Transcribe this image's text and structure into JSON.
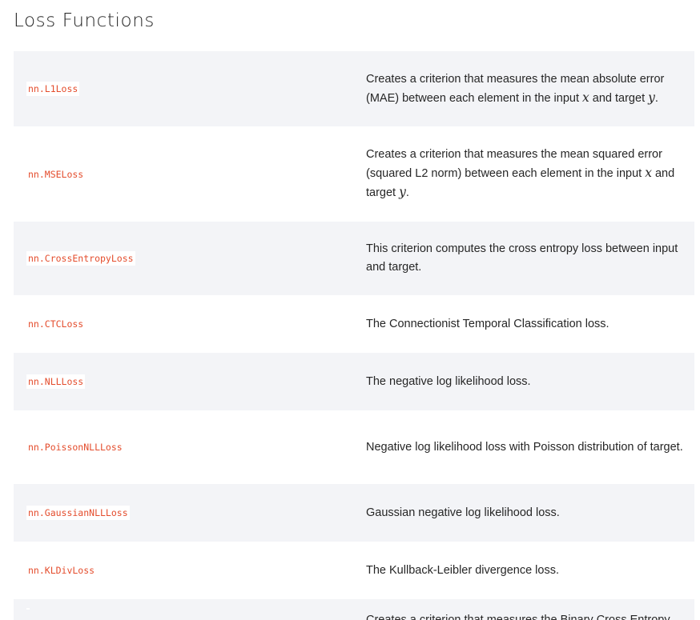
{
  "page": {
    "title": "Loss Functions"
  },
  "rows": [
    {
      "name": "nn.L1Loss",
      "desc_before": "Creates a criterion that measures the mean absolute error (MAE) between each element in the input ",
      "var1": "x",
      "desc_middle": " and target ",
      "var2": "y",
      "desc_after": "."
    },
    {
      "name": "nn.MSELoss",
      "desc_before": "Creates a criterion that measures the mean squared error (squared L2 norm) between each element in the input ",
      "var1": "x",
      "desc_middle": " and target ",
      "var2": "y",
      "desc_after": "."
    },
    {
      "name": "nn.CrossEntropyLoss",
      "desc": "This criterion computes the cross entropy loss between input and target."
    },
    {
      "name": "nn.CTCLoss",
      "desc": "The Connectionist Temporal Classification loss."
    },
    {
      "name": "nn.NLLLoss",
      "desc": "The negative log likelihood loss."
    },
    {
      "name": "nn.PoissonNLLLoss",
      "desc": "Negative log likelihood loss with Poisson distribution of target."
    },
    {
      "name": "nn.GaussianNLLLoss",
      "desc": "Gaussian negative log likelihood loss."
    },
    {
      "name": "nn.KLDivLoss",
      "desc": "The Kullback-Leibler divergence loss."
    },
    {
      "name": "",
      "desc": "Creates a criterion that measures the Binary Cross Entropy"
    }
  ],
  "colors": {
    "link": "#e44c2c",
    "row_alt": "#f3f4f7",
    "text": "#262626"
  }
}
